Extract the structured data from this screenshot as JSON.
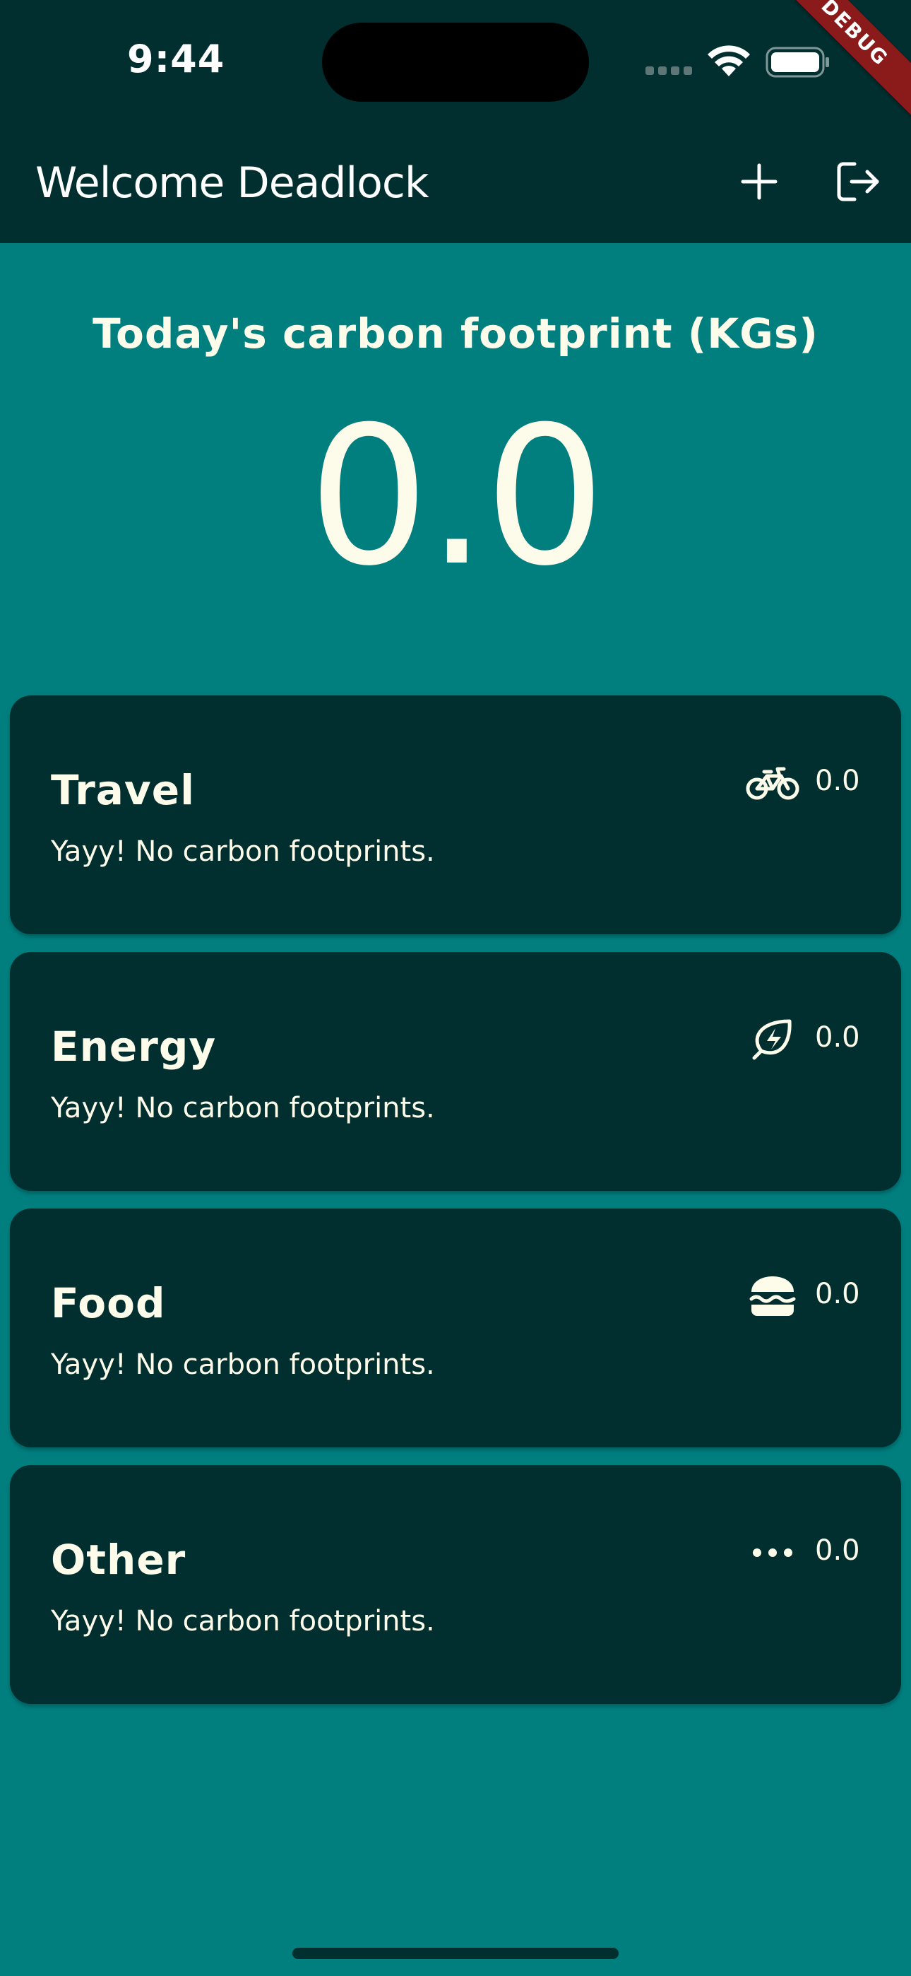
{
  "status_bar": {
    "time": "9:44",
    "debug_label": "DEBUG"
  },
  "app_bar": {
    "title": "Welcome Deadlock",
    "actions": [
      {
        "name": "add",
        "icon": "plus-icon"
      },
      {
        "name": "logout",
        "icon": "logout-icon"
      }
    ]
  },
  "summary": {
    "title": "Today's carbon footprint (KGs)",
    "value": "0.0"
  },
  "categories": [
    {
      "title": "Travel",
      "subtitle": "Yayy! No carbon footprints.",
      "value": "0.0",
      "icon": "bicycle-icon"
    },
    {
      "title": "Energy",
      "subtitle": "Yayy! No carbon footprints.",
      "value": "0.0",
      "icon": "leaf-bolt-icon"
    },
    {
      "title": "Food",
      "subtitle": "Yayy! No carbon footprints.",
      "value": "0.0",
      "icon": "burger-icon"
    },
    {
      "title": "Other",
      "subtitle": "Yayy! No carbon footprints.",
      "value": "0.0",
      "icon": "more-horizontal-icon"
    }
  ],
  "colors": {
    "background": "#017f7f",
    "header": "#012f30",
    "card": "#012f30",
    "text": "#fdfbe9",
    "debug": "#8b1a1a"
  }
}
